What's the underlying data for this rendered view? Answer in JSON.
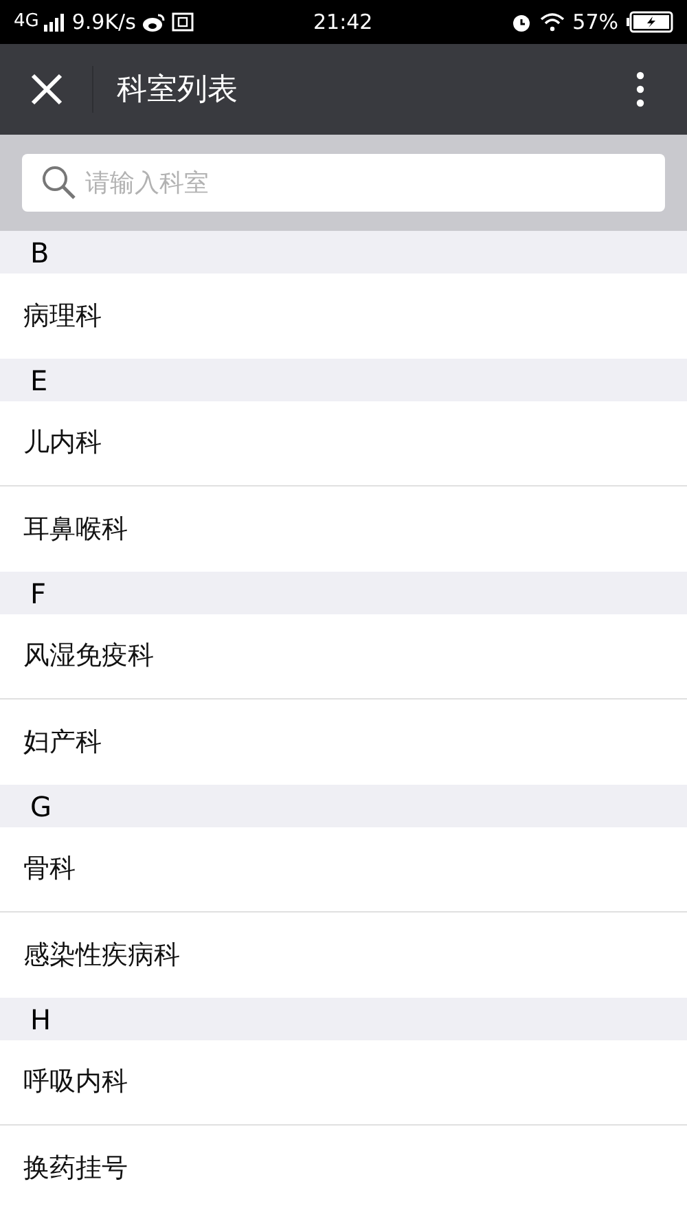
{
  "status_bar": {
    "network": "4G",
    "speed": "9.9K/s",
    "time": "21:42",
    "battery": "57%"
  },
  "header": {
    "title": "科室列表"
  },
  "search": {
    "placeholder": "请输入科室"
  },
  "sections": [
    {
      "letter": "B",
      "items": [
        "病理科"
      ]
    },
    {
      "letter": "E",
      "items": [
        "儿内科",
        "耳鼻喉科"
      ]
    },
    {
      "letter": "F",
      "items": [
        "风湿免疫科",
        "妇产科"
      ]
    },
    {
      "letter": "G",
      "items": [
        "骨科",
        "感染性疾病科"
      ]
    },
    {
      "letter": "H",
      "items": [
        "呼吸内科",
        "换药挂号"
      ]
    }
  ]
}
